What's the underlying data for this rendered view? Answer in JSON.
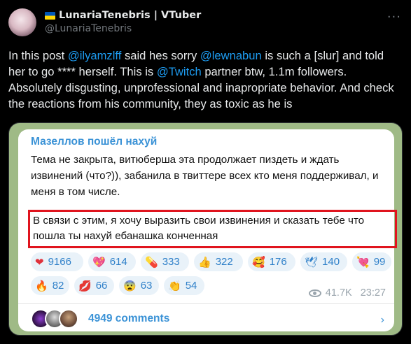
{
  "author": {
    "display_name": "LunariaTenebris | VTuber",
    "handle": "@LunariaTenebris"
  },
  "tweet": {
    "t1": "In this post ",
    "m1": "@ilyamzlff",
    "t2": " said hes sorry ",
    "m2": "@lewnabun",
    "t3": " is such a [slur] and told her to go **** herself. This is ",
    "m3": "@Twitch",
    "t4": " partner btw, 1.1m followers. Absolutely disgusting, unprofessional and inapropriate behavior. And check the reactions from his community, they as toxic as he is"
  },
  "telegram": {
    "channel": "Мазеллов пошёл нахуй",
    "body": "Тема не закрыта, витюберша эта продолжает пиздеть и ждать извинений (что?)), забанила в твиттере всех кто меня поддерживал, и меня в том числе.",
    "highlighted": "В связи с этим, я хочу выразить свои извинения и сказать тебе что пошла ты нахуй ебанашка конченная",
    "reactions_row1": [
      {
        "emoji": "❤",
        "count": "9166"
      },
      {
        "emoji": "💖",
        "count": "614"
      },
      {
        "emoji": "💊",
        "count": "333"
      },
      {
        "emoji": "👍",
        "count": "322"
      },
      {
        "emoji": "🥰",
        "count": "176"
      },
      {
        "emoji": "🕊",
        "count": "140"
      },
      {
        "emoji": "💘",
        "count": "99"
      }
    ],
    "reactions_row2": [
      {
        "emoji": "🔥",
        "count": "82"
      },
      {
        "emoji": "💋",
        "count": "66"
      },
      {
        "emoji": "😨",
        "count": "63"
      },
      {
        "emoji": "👏",
        "count": "54"
      }
    ],
    "views": "41.7K",
    "time": "23:27",
    "comments": "4949 comments",
    "chevron": "›"
  },
  "icons": {
    "more": "···"
  },
  "colors": {
    "mention": "#1d9bf0",
    "highlight_border": "#e0141e",
    "telegram_link": "#3a92d6",
    "chat_bg": "#9fba86"
  }
}
